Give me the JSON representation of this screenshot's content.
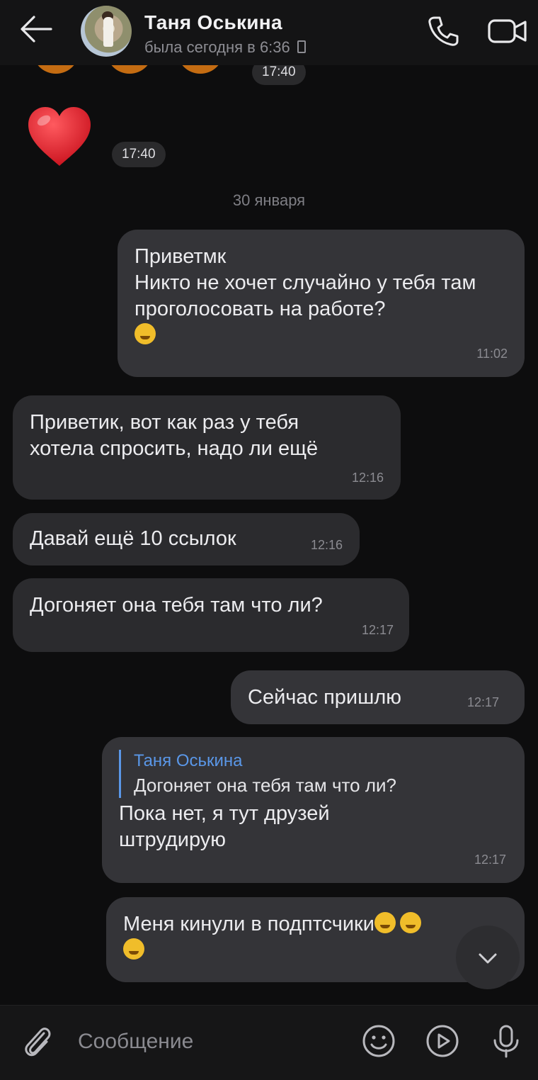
{
  "header": {
    "contact_name": "Таня Оськина",
    "status": "была сегодня в 6:36"
  },
  "messages": {
    "m0": {
      "time": "17:40"
    },
    "m1": {
      "time": "17:40"
    },
    "date": "30 января",
    "m2": {
      "text": "Приветмк\nНикто не хочет случайно у тебя там проголосовать на работе?",
      "time": "11:02"
    },
    "m3": {
      "text": "Приветик, вот как раз у тебя\nхотела спросить, надо ли ещё",
      "time": "12:16"
    },
    "m4": {
      "text": "Давай ещё 10 ссылок",
      "time": "12:16"
    },
    "m5": {
      "text": "Догоняет она тебя там что ли?",
      "time": "12:17"
    },
    "m6": {
      "text": "Сейчас пришлю",
      "time": "12:17"
    },
    "m7": {
      "reply_author": "Таня Оськина",
      "reply_text": "Догоняет она тебя там что ли?",
      "text": "Пока нет, я тут друзей\nштрудирую",
      "time": "12:17"
    },
    "m8": {
      "text": "Меня кинули в подптсчики"
    }
  },
  "composer": {
    "placeholder": "Сообщение"
  },
  "icons": {
    "back": "arrow-left-icon",
    "call": "phone-icon",
    "video": "video-camera-icon",
    "attach": "paperclip-icon",
    "emoji": "smiley-icon",
    "video_message": "play-circle-icon",
    "voice": "microphone-icon",
    "scroll_down": "chevron-down-icon"
  },
  "colors": {
    "background": "#0d0d0e",
    "bubble_incoming": "#2b2b2e",
    "bubble_outgoing": "#343438",
    "reply_accent": "#5a97e8",
    "heart": "#e0222e"
  }
}
